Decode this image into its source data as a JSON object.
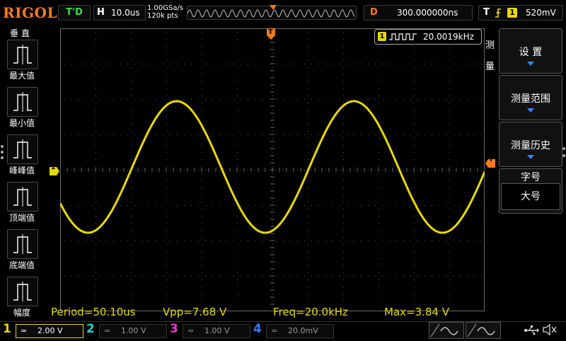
{
  "top": {
    "brand": "RIGOL",
    "run_state": "T'D",
    "horizontal": {
      "letter": "H",
      "timebase": "10.0us",
      "sample_rate": "1.00GSa/s",
      "points": "120k pts"
    },
    "delay": {
      "letter": "D",
      "value": "300.000000ns"
    },
    "trigger": {
      "letter": "T",
      "source": "1",
      "level": "520mV"
    }
  },
  "left_menu": {
    "title": "垂直",
    "items": [
      {
        "label": "最大值",
        "icon": "max-measure-icon"
      },
      {
        "label": "最小值",
        "icon": "min-measure-icon"
      },
      {
        "label": "峰峰值",
        "icon": "peak-to-peak-icon"
      },
      {
        "label": "顶端值",
        "icon": "top-value-icon"
      },
      {
        "label": "底端值",
        "icon": "base-value-icon"
      },
      {
        "label": "幅度",
        "icon": "amplitude-icon"
      }
    ]
  },
  "screen": {
    "freq_badge": {
      "channel": "1",
      "value": "20.0019kHz"
    },
    "trigger_marker": "T",
    "channel_marker": "1",
    "waveform_color": "#e8d900"
  },
  "right_menu": {
    "side_title": "测量",
    "items": [
      {
        "label": "设 置",
        "has_arrow": true
      },
      {
        "label": "测量范围",
        "has_arrow": true
      },
      {
        "label": "测量历史",
        "has_arrow": true
      }
    ],
    "font_group": {
      "title": "字号",
      "value": "大号"
    }
  },
  "measurements": {
    "period": "Period=50.10us",
    "vpp": "Vpp=7.68 V",
    "freq": "Freq=20.0kHz",
    "max": "Max=3.84 V"
  },
  "bottom": {
    "channels": [
      {
        "num": "1",
        "scale": "2.00 V",
        "color": "#e8d900"
      },
      {
        "num": "2",
        "scale": "1.00 V",
        "color": "#2bd1c8"
      },
      {
        "num": "3",
        "scale": "1.00 V",
        "color": "#e23bd6"
      },
      {
        "num": "4",
        "scale": "20.0mV",
        "color": "#3a7bff"
      }
    ]
  }
}
